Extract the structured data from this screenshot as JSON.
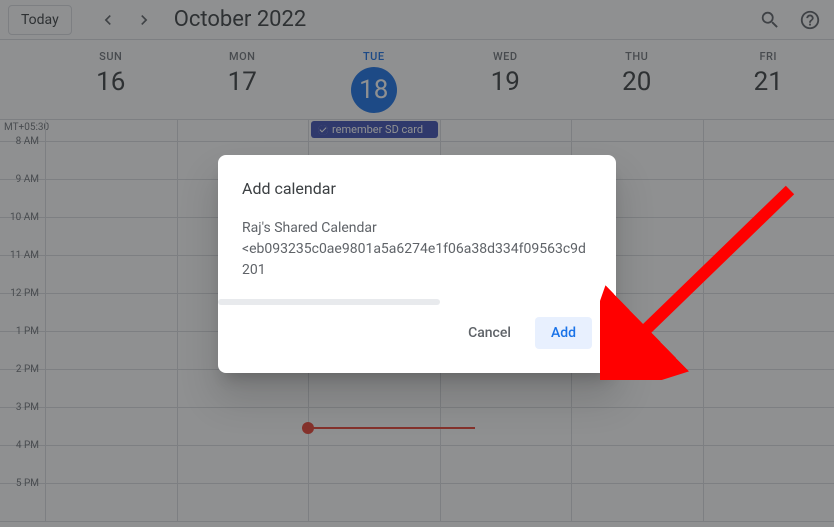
{
  "header": {
    "today_label": "Today",
    "month_label": "October 2022"
  },
  "timezone": "MT+05:30",
  "days": [
    {
      "name": "SUN",
      "number": "16",
      "is_today": false
    },
    {
      "name": "MON",
      "number": "17",
      "is_today": false
    },
    {
      "name": "TUE",
      "number": "18",
      "is_today": true
    },
    {
      "name": "WED",
      "number": "19",
      "is_today": false
    },
    {
      "name": "THU",
      "number": "20",
      "is_today": false
    },
    {
      "name": "FRI",
      "number": "21",
      "is_today": false
    }
  ],
  "event": {
    "label": "remember SD card"
  },
  "time_slots": [
    "8 AM",
    "9 AM",
    "10 AM",
    "11 AM",
    "12 PM",
    "1 PM",
    "2 PM",
    "3 PM",
    "4 PM",
    "5 PM"
  ],
  "modal": {
    "title": "Add calendar",
    "body_line1": "Raj's Shared Calendar",
    "body_line2": "<eb093235c0ae9801a5a6274e1f06a38d334f09563c9d201",
    "cancel_label": "Cancel",
    "add_label": "Add"
  }
}
